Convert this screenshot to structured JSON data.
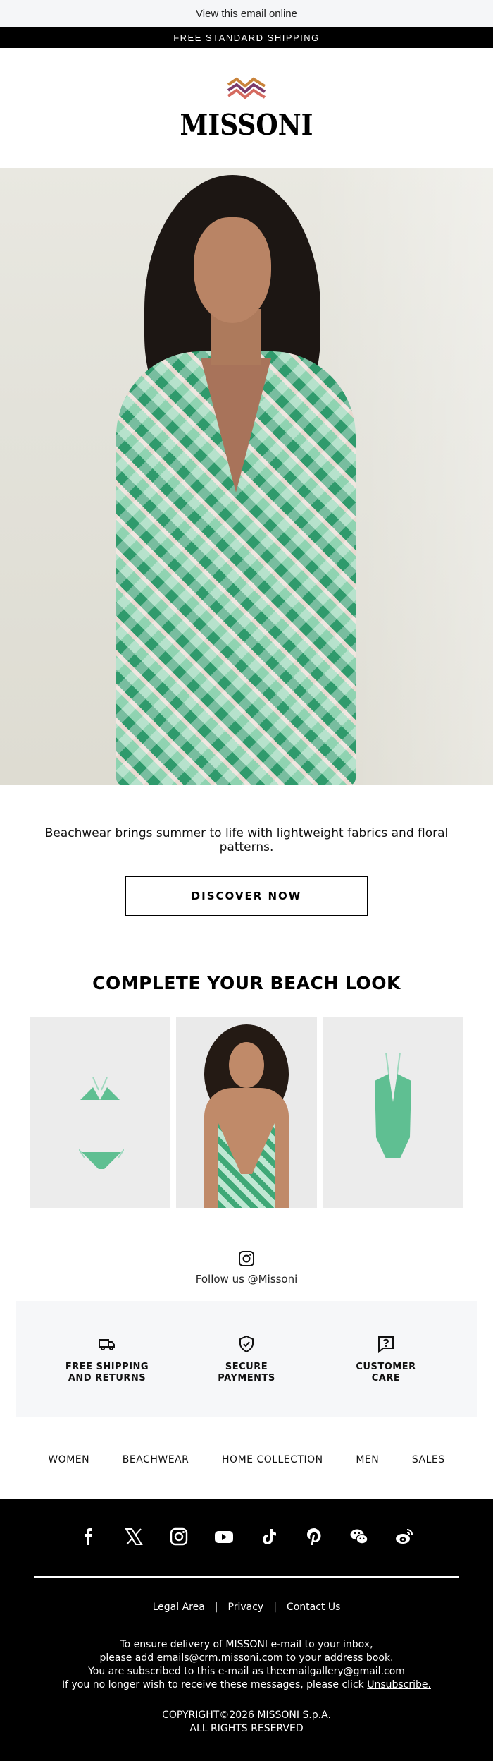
{
  "header": {
    "view_online": "View this email online",
    "shipping_banner": "FREE STANDARD SHIPPING",
    "logo_text": "MISSONI"
  },
  "intro": {
    "text": "Beachwear brings summer to life with lightweight fabrics and floral patterns.",
    "cta_label": "DISCOVER NOW"
  },
  "beach_look": {
    "title": "COMPLETE YOUR BEACH LOOK"
  },
  "follow": {
    "text": "Follow us @Missoni"
  },
  "services": [
    {
      "label": "FREE SHIPPING\nAND RETURNS",
      "icon": "truck-icon"
    },
    {
      "label": "SECURE\nPAYMENTS",
      "icon": "shield-check-icon"
    },
    {
      "label": "CUSTOMER\nCARE",
      "icon": "help-chat-icon"
    }
  ],
  "categories": [
    "WOMEN",
    "BEACHWEAR",
    "HOME COLLECTION",
    "MEN",
    "SALES"
  ],
  "footer": {
    "socials": [
      "facebook-icon",
      "x-icon",
      "instagram-icon",
      "youtube-icon",
      "tiktok-icon",
      "pinterest-icon",
      "wechat-icon",
      "weibo-icon"
    ],
    "legal_area": "Legal Area",
    "privacy": "Privacy",
    "contact_us": "Contact Us",
    "separator": "|",
    "notice_line1": "To ensure delivery of MISSONI e-mail to your inbox,",
    "notice_line2": "please add emails@crm.missoni.com to your address book.",
    "notice_line3": "You are subscribed to this e-mail as theemailgallery@gmail.com",
    "notice_line4_prefix": "If you no longer wish to receive these messages, please click ",
    "unsubscribe": "Unsubscribe.",
    "copyright_line1": "COPYRIGHT©2026 MISSONI S.p.A.",
    "copyright_line2": "ALL RIGHTS RESERVED"
  },
  "colors": {
    "black": "#000000",
    "topbar_bg": "#f5f6f8",
    "service_bg": "#f6f7f9",
    "logo_mark": [
      "#c9833a",
      "#d9a23c",
      "#7b3b6b",
      "#d56a5f"
    ]
  }
}
